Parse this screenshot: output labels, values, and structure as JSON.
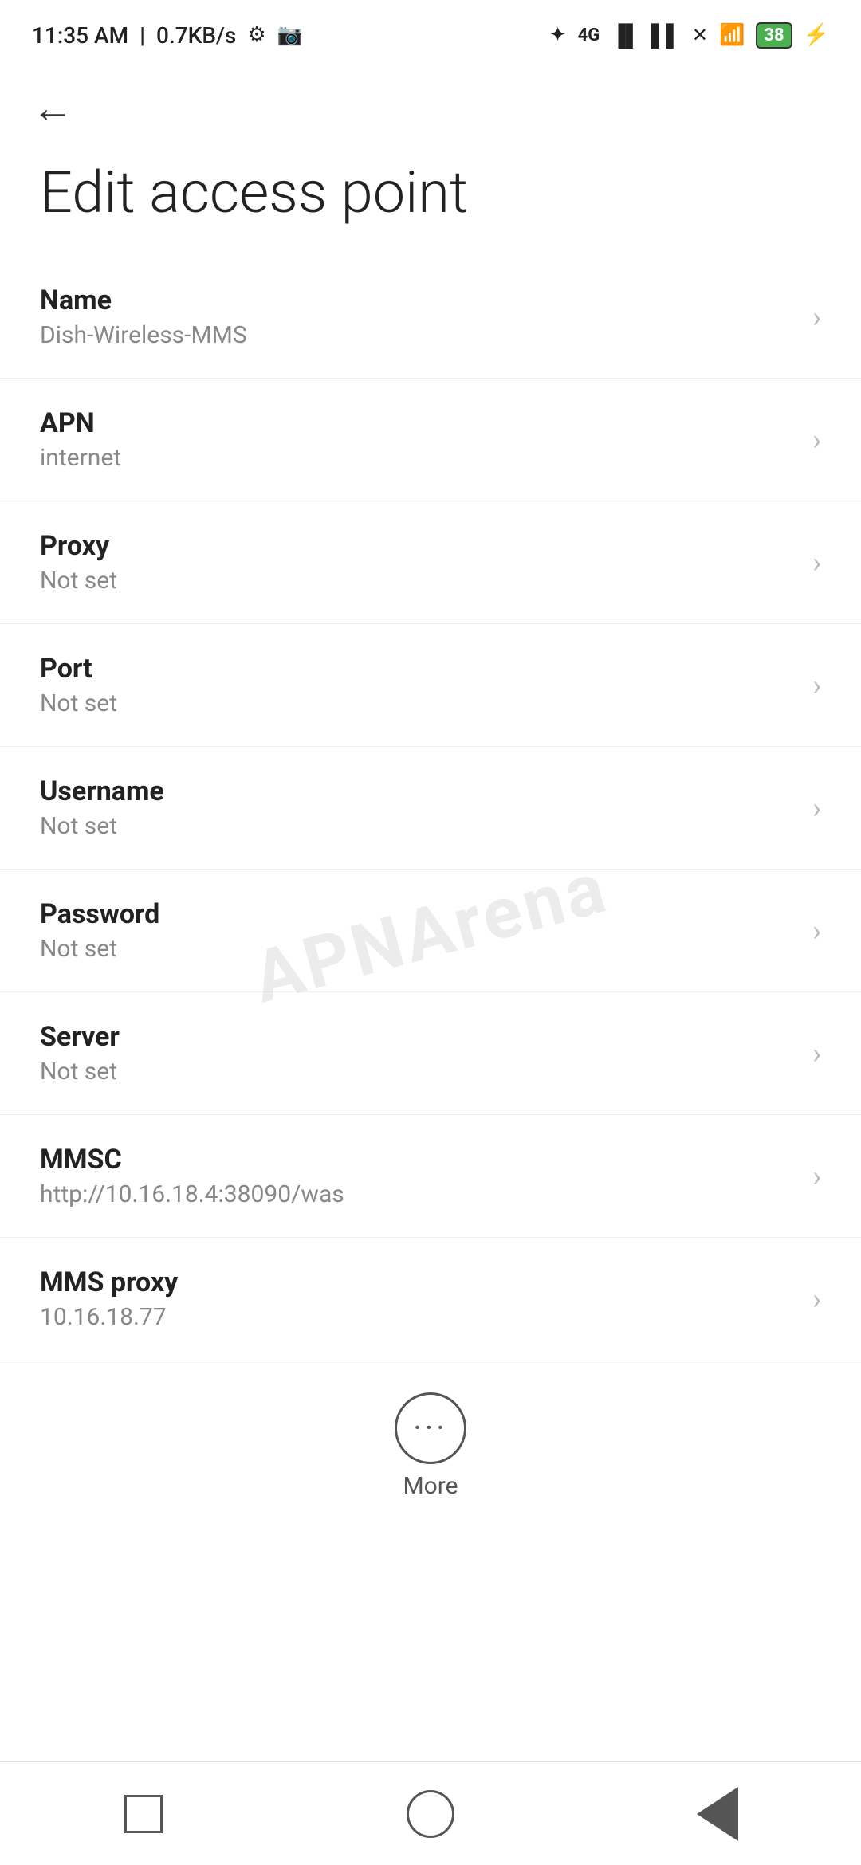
{
  "statusBar": {
    "time": "11:35 AM",
    "network": "0.7KB/s",
    "battery": "38",
    "batteryIcon": "⚡"
  },
  "page": {
    "title": "Edit access point"
  },
  "settings": [
    {
      "label": "Name",
      "value": "Dish-Wireless-MMS"
    },
    {
      "label": "APN",
      "value": "internet"
    },
    {
      "label": "Proxy",
      "value": "Not set"
    },
    {
      "label": "Port",
      "value": "Not set"
    },
    {
      "label": "Username",
      "value": "Not set"
    },
    {
      "label": "Password",
      "value": "Not set"
    },
    {
      "label": "Server",
      "value": "Not set"
    },
    {
      "label": "MMSC",
      "value": "http://10.16.18.4:38090/was"
    },
    {
      "label": "MMS proxy",
      "value": "10.16.18.77"
    }
  ],
  "more": {
    "label": "More"
  },
  "watermark": "APNArena"
}
